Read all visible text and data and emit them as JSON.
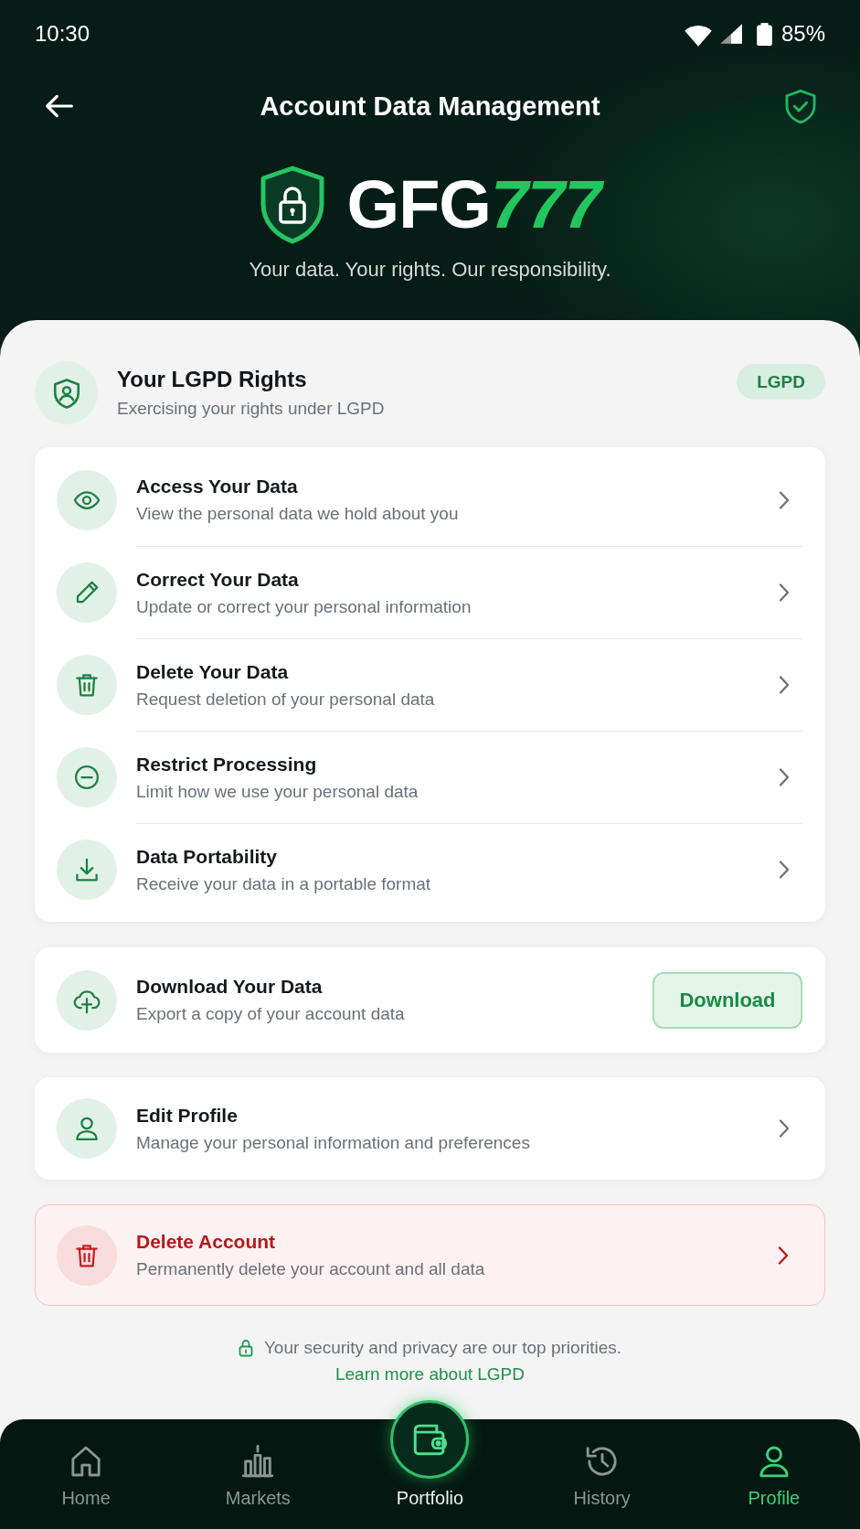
{
  "status_bar": {
    "time": "10:30",
    "battery": "85%"
  },
  "app_bar": {
    "title": "Account Data Management"
  },
  "brand": {
    "logo_letters": "GFG",
    "logo_digits": "777",
    "tagline": "Your data. Your rights. Our responsibility."
  },
  "rights": {
    "title": "Your LGPD Rights",
    "subtitle": "Exercising your rights under LGPD",
    "badge": "LGPD",
    "items": [
      {
        "title": "Access Your Data",
        "subtitle": "View the personal data we hold about you"
      },
      {
        "title": "Correct Your Data",
        "subtitle": "Update or correct your personal information"
      },
      {
        "title": "Delete Your Data",
        "subtitle": "Request deletion of your personal data"
      },
      {
        "title": "Restrict Processing",
        "subtitle": "Limit how we use your personal data"
      },
      {
        "title": "Data Portability",
        "subtitle": "Receive your data in a portable format"
      }
    ]
  },
  "cards": [
    {
      "kind": "download",
      "title": "Download Your Data",
      "subtitle": "Export a copy of your account data",
      "button": "Download"
    },
    {
      "kind": "link",
      "title": "Edit Profile",
      "subtitle": "Manage your personal information and preferences"
    },
    {
      "kind": "danger",
      "title": "Delete Account",
      "subtitle": "Permanently delete your account and all data"
    }
  ],
  "footer": {
    "note": "Your security and privacy are our top priorities.",
    "link": "Learn more about LGPD"
  },
  "bottom_nav": [
    {
      "label": "Home",
      "kind": "tab",
      "selected": false
    },
    {
      "label": "Markets",
      "kind": "tab",
      "selected": false
    },
    {
      "label": "Portfolio",
      "kind": "center",
      "selected": false
    },
    {
      "label": "History",
      "kind": "tab",
      "selected": false
    },
    {
      "label": "Profile",
      "kind": "tab",
      "selected": true
    }
  ]
}
